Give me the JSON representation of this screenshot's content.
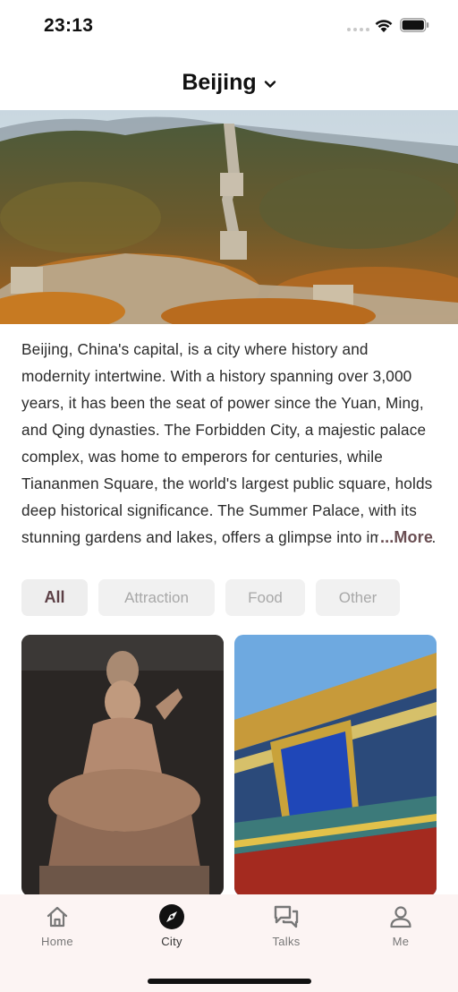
{
  "status": {
    "time": "23:13"
  },
  "header": {
    "city": "Beijing"
  },
  "description": {
    "text": "Beijing, China's capital, is a city where history and modernity intertwine. With a history spanning over 3,000 years, it has been the seat of power since the Yuan, Ming, and Qing dynasties. The Forbidden City, a majestic palace complex, was home to emperors for centuries, while Tiananmen Square, the world's largest public square, holds deep historical significance. The Summer Palace, with its stunning gardens and lakes, offers a glimpse into imperial leisure.",
    "more_label": "...More"
  },
  "filters": [
    {
      "label": "All",
      "active": true
    },
    {
      "label": "Attraction",
      "active": false
    },
    {
      "label": "Food",
      "active": false
    },
    {
      "label": "Other",
      "active": false
    }
  ],
  "tabs": [
    {
      "label": "Home",
      "icon": "home-icon"
    },
    {
      "label": "City",
      "icon": "compass-icon",
      "active": true
    },
    {
      "label": "Talks",
      "icon": "chat-icon"
    },
    {
      "label": "Me",
      "icon": "person-icon"
    }
  ],
  "colors": {
    "accent": "#5c3f45",
    "tabbar_bg": "#fcf4f3",
    "chip_bg": "#f1f1f1"
  }
}
